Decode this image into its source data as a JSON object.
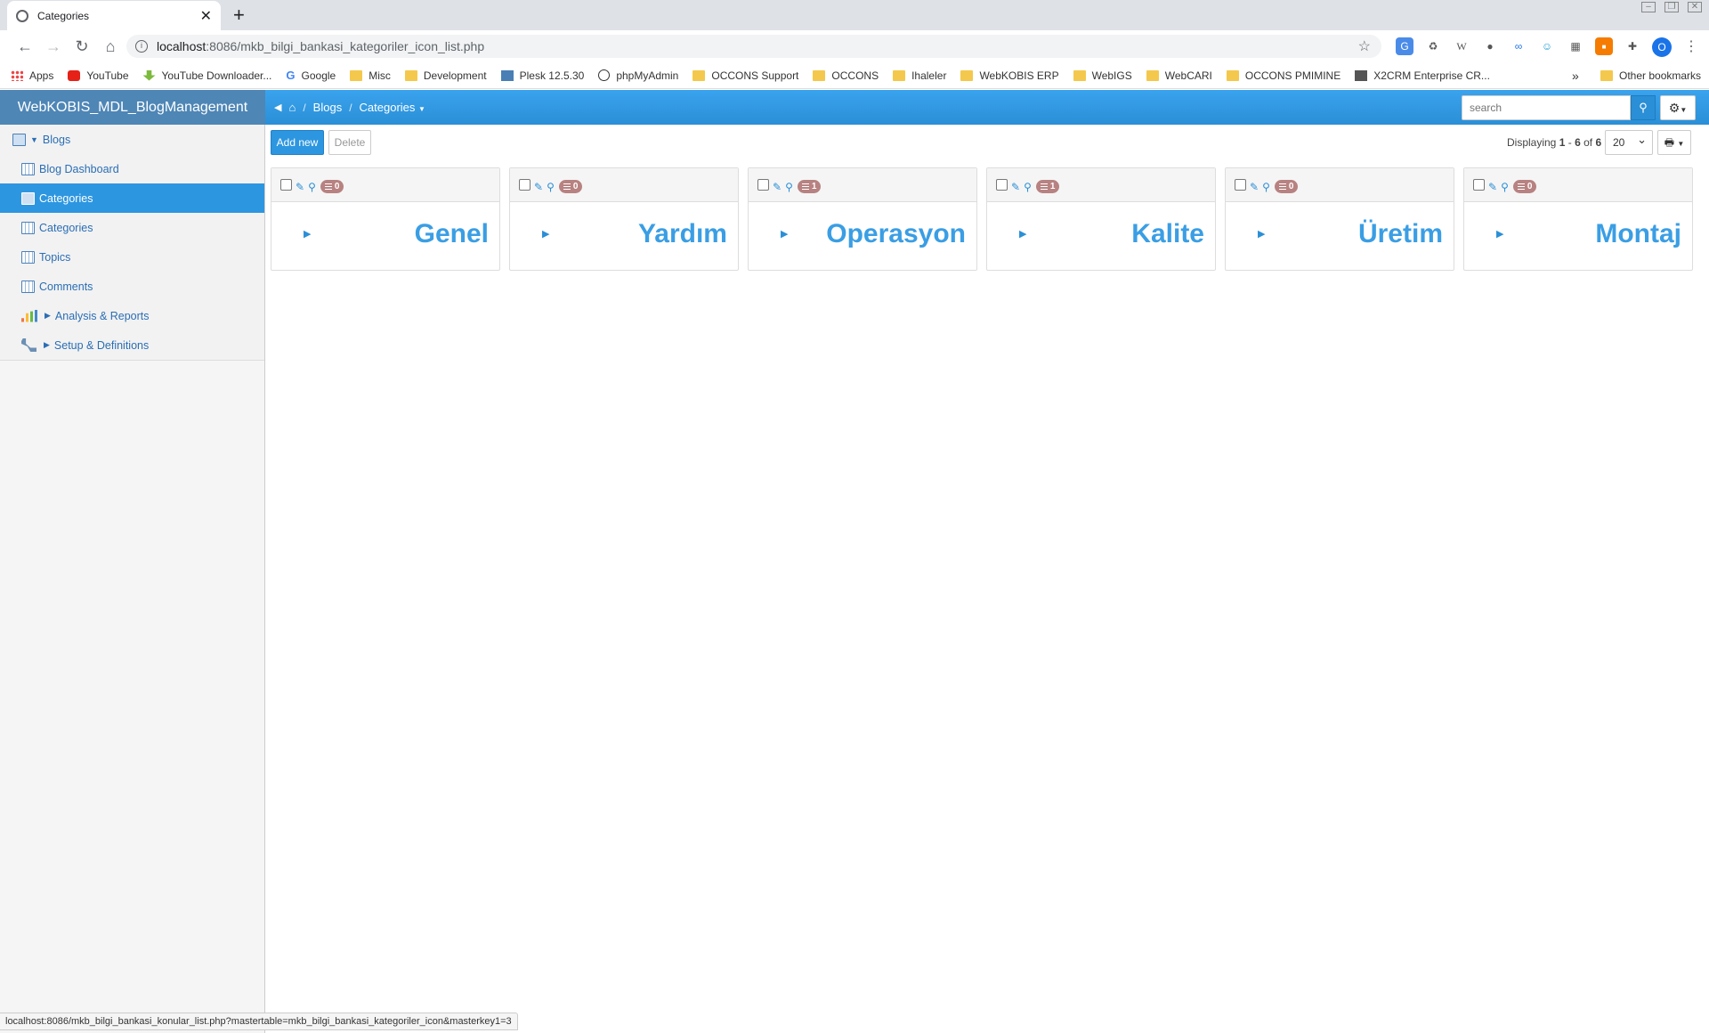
{
  "browser": {
    "tab_title": "Categories",
    "url_host": "localhost",
    "url_rest": ":8086/mkb_bilgi_bankasi_kategoriler_icon_list.php",
    "profile_initial": "O",
    "bookmarks": [
      "Apps",
      "YouTube",
      "YouTube Downloader...",
      "Google",
      "Misc",
      "Development",
      "Plesk 12.5.30",
      "phpMyAdmin",
      "OCCONS Support",
      "OCCONS",
      "Ihaleler",
      "WebKOBIS ERP",
      "WebIGS",
      "WebCARI",
      "OCCONS PMIMINE",
      "X2CRM Enterprise CR..."
    ],
    "other_bookmarks": "Other bookmarks",
    "status_url": "localhost:8086/mkb_bilgi_bankasi_konular_list.php?mastertable=mkb_bilgi_bankasi_kategoriler_icon&masterkey1=3"
  },
  "app": {
    "brand": "WebKOBIS_MDL_BlogManagement",
    "breadcrumb": {
      "blogs": "Blogs",
      "categories": "Categories"
    },
    "search_placeholder": "search"
  },
  "sidebar": {
    "group": "Blogs",
    "items": [
      "Blog Dashboard",
      "Categories",
      "Categories",
      "Topics",
      "Comments"
    ],
    "analysis": "Analysis & Reports",
    "setup": "Setup & Definitions"
  },
  "toolbar": {
    "add_label": "Add new",
    "delete_label": "Delete",
    "display_prefix": "Displaying",
    "range_start": "1",
    "range_end": "6",
    "of_label": "of",
    "total": "6",
    "page_size": "20"
  },
  "cards": [
    {
      "name": "Genel",
      "count": "0"
    },
    {
      "name": "Yardım",
      "count": "0"
    },
    {
      "name": "Operasyon",
      "count": "1"
    },
    {
      "name": "Kalite",
      "count": "1"
    },
    {
      "name": "Üretim",
      "count": "0"
    },
    {
      "name": "Montaj",
      "count": "0"
    }
  ]
}
